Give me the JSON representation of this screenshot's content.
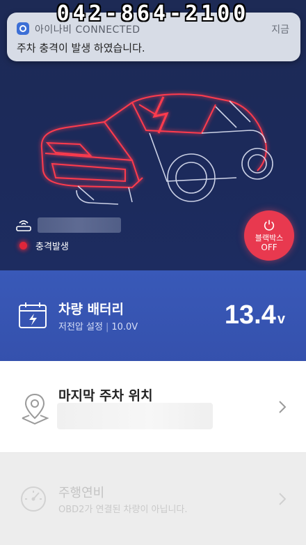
{
  "overlay": {
    "phone": "042-864-2100"
  },
  "notification": {
    "app_name": "아이나비 CONNECTED",
    "time": "지금",
    "message": "주차 충격이 발생 하였습니다.",
    "icon": "app-icon"
  },
  "hero": {
    "router_icon": "router-icon",
    "status_text": "충격발생",
    "blackbox": {
      "label": "블랙박스",
      "state": "OFF",
      "icon": "power-icon"
    }
  },
  "battery": {
    "title": "차량 배터리",
    "sub_label": "저전압 설정",
    "sub_value": "10.0V",
    "value": "13.4",
    "unit": "v",
    "icon": "battery-calendar-icon"
  },
  "parking": {
    "title": "마지막 주차 위치",
    "icon": "map-pin-icon"
  },
  "fuel": {
    "title": "주행연비",
    "subtitle": "OBD2가 연결된 차량이 아닙니다.",
    "icon": "gauge-icon"
  },
  "colors": {
    "hero_bg": "#1d2a55",
    "battery_bg": "#3959b8",
    "alert_red": "#e8394f"
  }
}
